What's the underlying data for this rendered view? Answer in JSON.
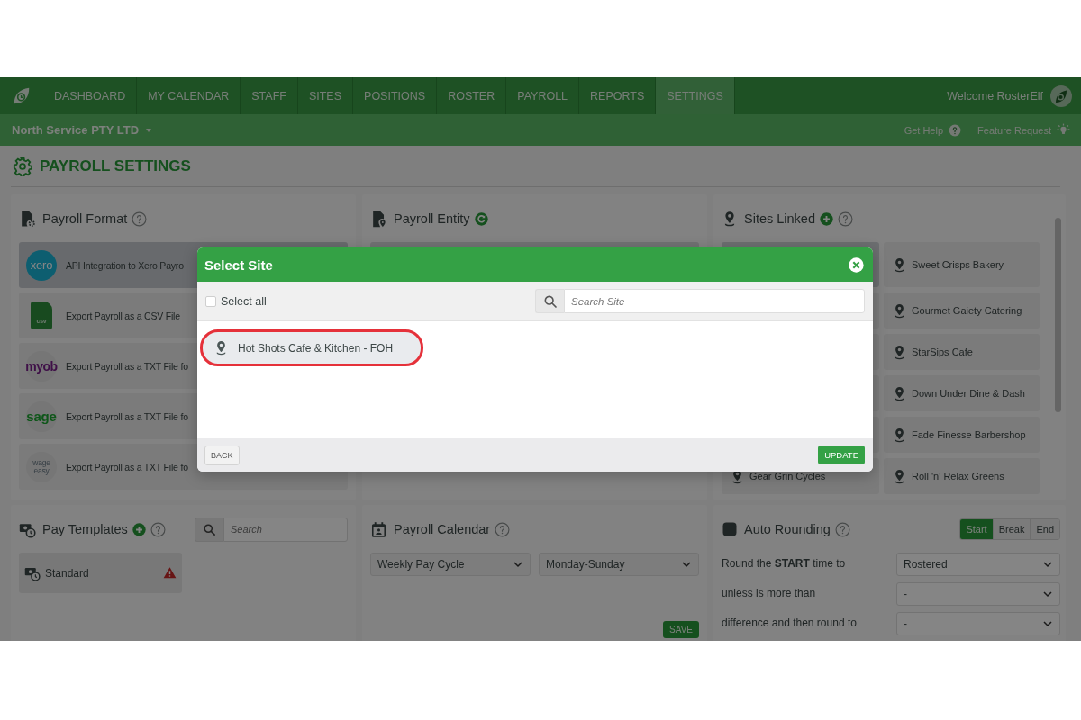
{
  "nav": {
    "items": [
      {
        "label": "DASHBOARD",
        "selected": false
      },
      {
        "label": "MY CALENDAR",
        "selected": false
      },
      {
        "label": "STAFF",
        "selected": false
      },
      {
        "label": "SITES",
        "selected": false
      },
      {
        "label": "POSITIONS",
        "selected": false
      },
      {
        "label": "ROSTER",
        "selected": false
      },
      {
        "label": "PAYROLL",
        "selected": false
      },
      {
        "label": "REPORTS",
        "selected": false
      },
      {
        "label": "SETTINGS",
        "selected": true
      }
    ],
    "welcome": "Welcome RosterElf"
  },
  "subbar": {
    "company": "North Service PTY LTD",
    "links": [
      {
        "label": "Get Help",
        "kind": "help"
      },
      {
        "label": "Feature Request",
        "kind": "idea"
      }
    ]
  },
  "page_title": "PAYROLL SETTINGS",
  "payroll_format": {
    "title": "Payroll Format",
    "options": [
      {
        "kind": "xero",
        "logo": "xero",
        "label": "API Integration to Xero Payro",
        "selected": true
      },
      {
        "kind": "file",
        "logo": "csv",
        "label": "Export Payroll as a CSV File",
        "selected": false
      },
      {
        "kind": "myob",
        "logo": "myob",
        "label": "Export Payroll as a TXT File fo",
        "selected": false
      },
      {
        "kind": "sage",
        "logo": "sage",
        "label": "Export Payroll as a TXT File fo",
        "selected": false
      },
      {
        "kind": "wageeasy",
        "logo": "wage easy",
        "label": "Export Payroll as a TXT File fo",
        "selected": false
      }
    ]
  },
  "payroll_entity": {
    "title": "Payroll Entity"
  },
  "sites_linked": {
    "title": "Sites Linked",
    "left_column": [
      {
        "label": "Gear Grin Cycles"
      }
    ],
    "right_column": [
      {
        "label": "Sweet Crisps Bakery"
      },
      {
        "label": "Gourmet Gaiety Catering"
      },
      {
        "label": "StarSips Cafe"
      },
      {
        "label": "Down Under Dine & Dash"
      },
      {
        "label": "Fade Finesse Barbershop"
      },
      {
        "label": "Roll 'n' Relax Greens"
      }
    ]
  },
  "pay_templates": {
    "title": "Pay Templates",
    "search_placeholder": "Search",
    "items": [
      {
        "label": "Standard",
        "warning": true
      }
    ]
  },
  "payroll_calendar": {
    "title": "Payroll Calendar",
    "selects": [
      "Weekly Pay Cycle",
      "Monday-Sunday"
    ],
    "save": "SAVE"
  },
  "auto_rounding": {
    "title": "Auto Rounding",
    "segments": [
      {
        "label": "Start",
        "selected": true
      },
      {
        "label": "Break",
        "selected": false
      },
      {
        "label": "End",
        "selected": false
      }
    ],
    "rows": [
      {
        "label": "Round the **START** time to",
        "value": "Rostered"
      },
      {
        "label": "unless is more than",
        "value": "-"
      },
      {
        "label": "difference and then round to",
        "value": "-"
      }
    ]
  },
  "modal": {
    "title": "Select Site",
    "select_all": {
      "label": "Select all",
      "checked": false
    },
    "search_placeholder": "Search Site",
    "sites": [
      {
        "label": "Hot Shots Cafe & Kitchen - FOH",
        "highlighted": true
      }
    ],
    "back": "BACK",
    "update": "UPDATE"
  }
}
